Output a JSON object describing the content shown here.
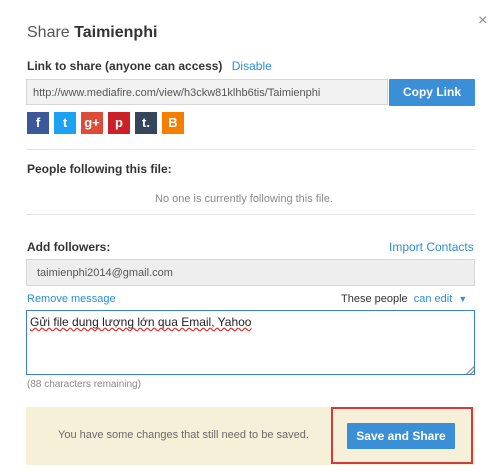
{
  "dialog": {
    "title_prefix": "Share ",
    "title_name": "Taimienphi",
    "close_glyph": "×"
  },
  "link_section": {
    "label": "Link to share (anyone can access)",
    "disable_label": "Disable",
    "url": "http://www.mediafire.com/view/h3ckw81klhb6tis/Taimienphi",
    "copy_label": "Copy Link"
  },
  "social": [
    {
      "icon": "facebook-icon",
      "glyph": "f",
      "color": "#3b5998"
    },
    {
      "icon": "twitter-icon",
      "glyph": "t",
      "color": "#1da1f2"
    },
    {
      "icon": "google-plus-icon",
      "glyph": "g+",
      "color": "#dd4b39"
    },
    {
      "icon": "pinterest-icon",
      "glyph": "p",
      "color": "#cb2027"
    },
    {
      "icon": "tumblr-icon",
      "glyph": "t.",
      "color": "#35465c"
    },
    {
      "icon": "blogger-icon",
      "glyph": "B",
      "color": "#f57d00"
    }
  ],
  "followers": {
    "label": "People following this file:",
    "empty_message": "No one is currently following this file."
  },
  "add_followers": {
    "label": "Add followers:",
    "import_label": "Import Contacts",
    "email_value": "taimienphi2014@gmail.com",
    "remove_message_label": "Remove message",
    "permission_prefix": "These people",
    "permission_value": "can edit",
    "permission_caret": "▼",
    "message_value": "Gửi file dung lượng lớn qua Email, Yahoo",
    "chars_remaining": "(88 characters remaining)"
  },
  "notice": {
    "text": "You have some changes that still need to be saved.",
    "save_label": "Save and Share"
  }
}
